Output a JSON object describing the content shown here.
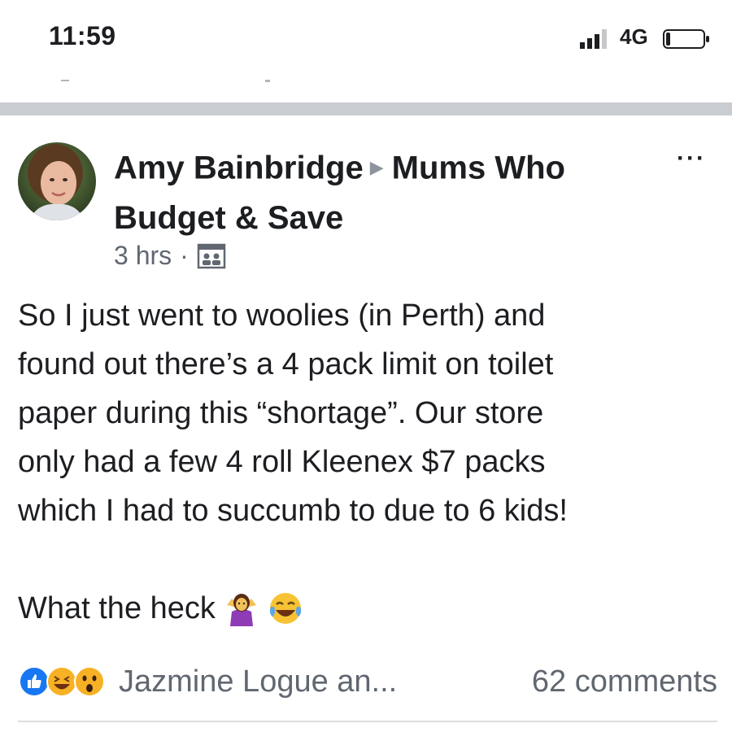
{
  "status_bar": {
    "time": "11:59",
    "network": "4G",
    "icons": [
      "signal-icon",
      "battery-icon"
    ]
  },
  "post": {
    "author": "Amy Bainbridge",
    "group": "Mums Who Budget & Save",
    "timestamp": "3 hrs",
    "separator": "·",
    "audience_icon": "group-icon",
    "more_label": "···",
    "body_lines": [
      "So I just went to woolies (in Perth) and",
      "found out there’s a 4 pack limit on toilet",
      "paper during this “shortage”. Our store",
      "only had a few 4 roll Kleenex $7 packs",
      "which I had to succumb to due to 6 kids!"
    ],
    "closing_text": "What the heck",
    "closing_emojis": [
      "woman-shrugging-emoji",
      "tears-of-joy-emoji"
    ],
    "reactions": {
      "icons": [
        "like-icon",
        "haha-icon",
        "wow-icon"
      ],
      "reactors": "Jazmine Logue an...",
      "comments": "62 comments"
    }
  },
  "colors": {
    "like_blue": "#1877f2",
    "reaction_yellow": "#f7b125",
    "secondary_text": "#606770",
    "divider": "#c9ccd1"
  }
}
